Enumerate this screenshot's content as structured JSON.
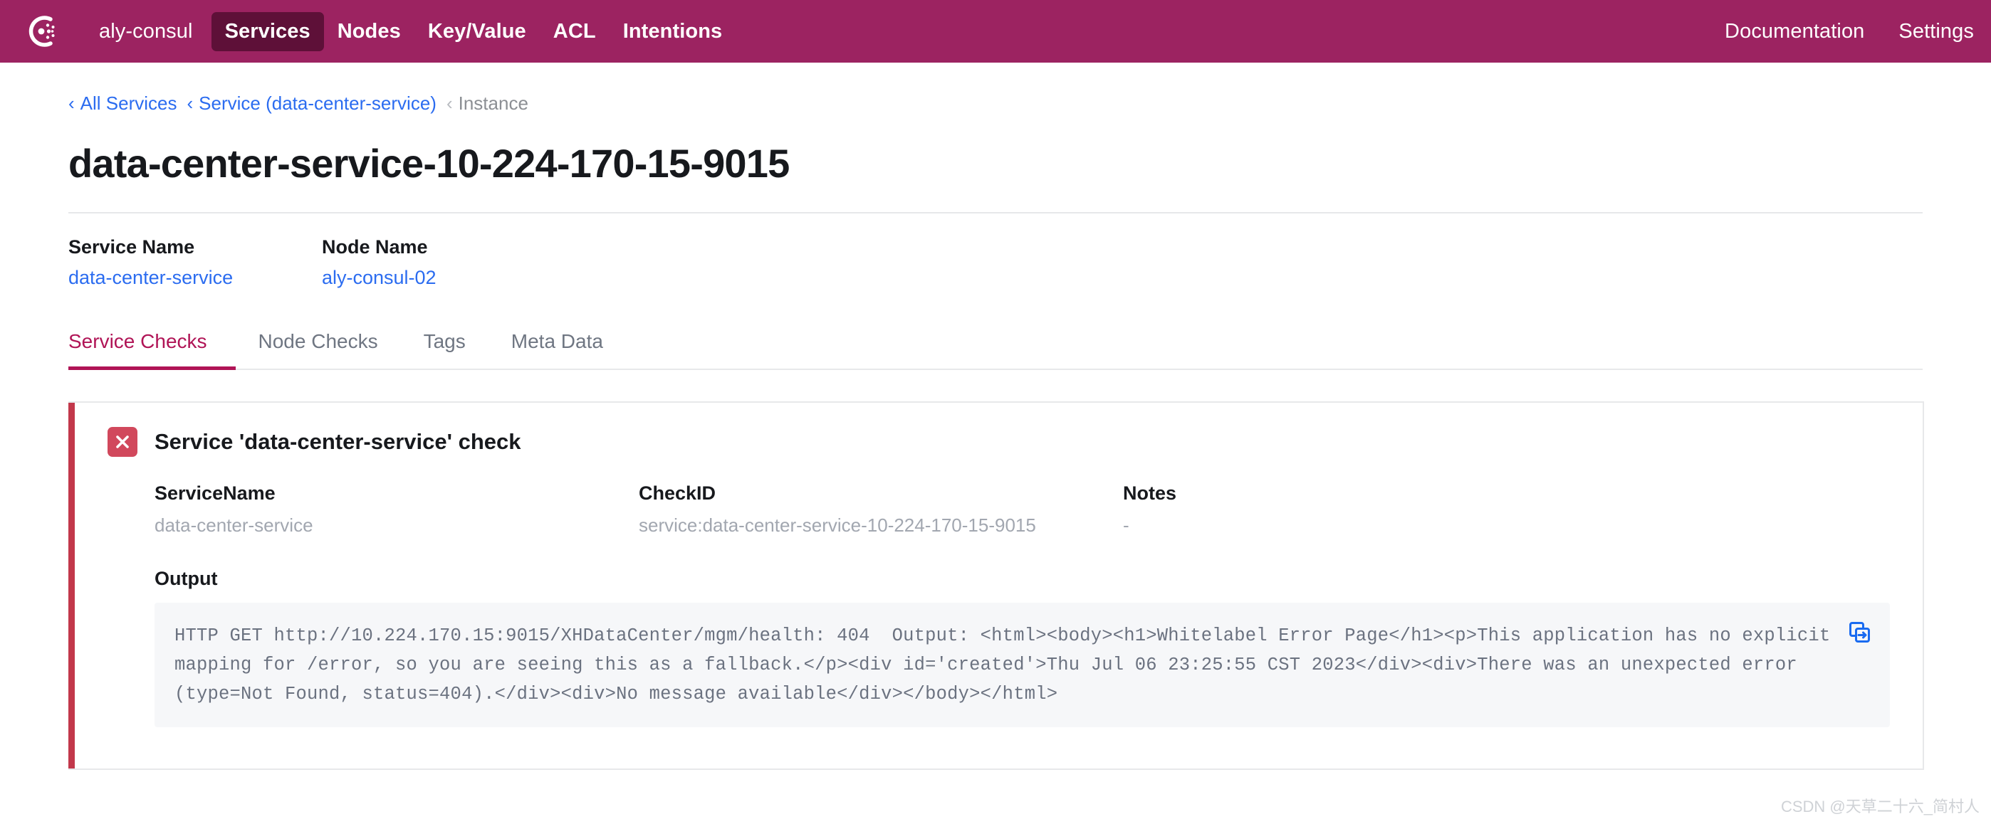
{
  "navbar": {
    "logo_icon": "consul-logo-icon",
    "brand": "aly-consul",
    "items": [
      {
        "label": "Services",
        "active": true
      },
      {
        "label": "Nodes",
        "active": false
      },
      {
        "label": "Key/Value",
        "active": false
      },
      {
        "label": "ACL",
        "active": false
      },
      {
        "label": "Intentions",
        "active": false
      }
    ],
    "right_items": [
      {
        "label": "Documentation"
      },
      {
        "label": "Settings"
      }
    ]
  },
  "breadcrumb": {
    "chevron": "‹",
    "items": [
      {
        "label": "All Services",
        "current": false
      },
      {
        "label": "Service (data-center-service)",
        "current": false
      },
      {
        "label": "Instance",
        "current": true
      }
    ]
  },
  "page": {
    "title": "data-center-service-10-224-170-15-9015",
    "meta": [
      {
        "label": "Service Name",
        "value": "data-center-service"
      },
      {
        "label": "Node Name",
        "value": "aly-consul-02"
      }
    ]
  },
  "tabs": [
    {
      "label": "Service Checks",
      "active": true
    },
    {
      "label": "Node Checks",
      "active": false
    },
    {
      "label": "Tags",
      "active": false
    },
    {
      "label": "Meta Data",
      "active": false
    }
  ],
  "check": {
    "status_icon": "x-mark-icon",
    "status_color": "#d1485c",
    "accent_color": "#c2384b",
    "title": "Service 'data-center-service' check",
    "fields": [
      {
        "label": "ServiceName",
        "value": "data-center-service"
      },
      {
        "label": "CheckID",
        "value": "service:data-center-service-10-224-170-15-9015"
      },
      {
        "label": "Notes",
        "value": "-"
      }
    ],
    "output_label": "Output",
    "output_text": "HTTP GET http://10.224.170.15:9015/XHDataCenter/mgm/health: 404  Output: <html><body><h1>Whitelabel Error Page</h1><p>This application has no explicit mapping for /error, so you are seeing this as a fallback.</p><div id='created'>Thu Jul 06 23:25:55 CST 2023</div><div>There was an unexpected error (type=Not Found, status=404).</div><div>No message available</div></body></html>",
    "copy_icon": "copy-icon"
  },
  "watermark": "CSDN @天草二十六_简村人",
  "colors": {
    "brand": "#9c2361",
    "nav_active": "#5e1038",
    "link": "#2b6cf0",
    "tab_active": "#b01456",
    "muted": "#a2a7b0"
  }
}
